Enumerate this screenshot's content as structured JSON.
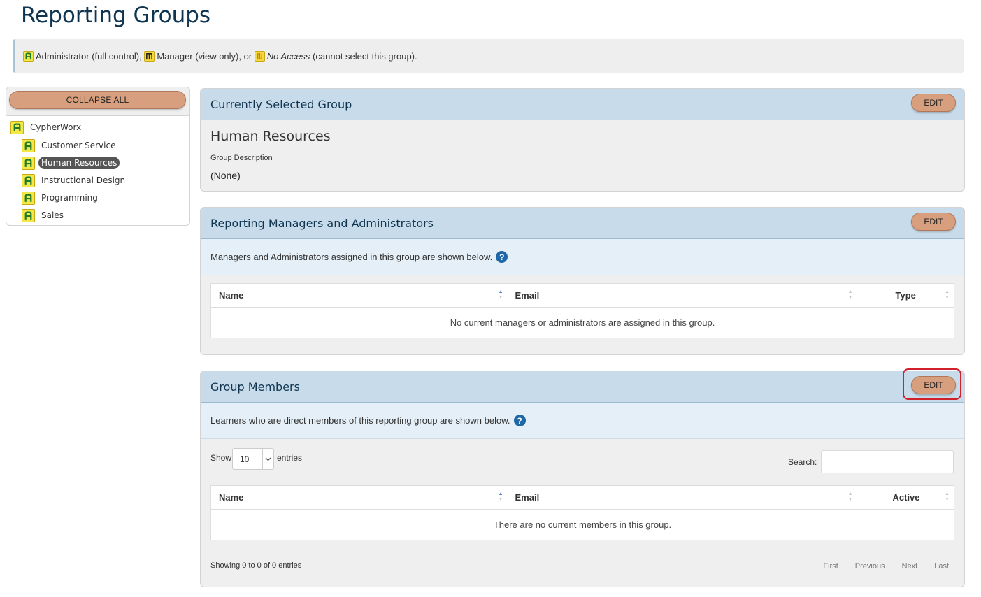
{
  "page": {
    "title": "Reporting Groups"
  },
  "legend": {
    "admin_label": "Administrator",
    "admin_desc": " (full control), ",
    "manager_label": "Manager",
    "manager_desc": " (view only), or ",
    "noaccess_label": "No Access",
    "noaccess_desc": " (cannot select this group)."
  },
  "colors": {
    "accent_button": "#d79f7e",
    "header_bg": "#c8dbea",
    "title": "#0f3550",
    "badge": "#f5d842",
    "highlight": "#d0202a"
  },
  "sidebar": {
    "collapse_label": "COLLAPSE ALL",
    "root": {
      "label": "CypherWorx",
      "icon": "admin-badge-icon"
    },
    "children": [
      {
        "label": "Customer Service",
        "icon": "admin-badge-icon"
      },
      {
        "label": "Human Resources",
        "icon": "admin-badge-icon",
        "selected": true
      },
      {
        "label": "Instructional Design",
        "icon": "admin-badge-icon"
      },
      {
        "label": "Programming",
        "icon": "admin-badge-icon"
      },
      {
        "label": "Sales",
        "icon": "admin-badge-icon"
      }
    ]
  },
  "selected_group": {
    "header": "Currently Selected Group",
    "edit_label": "EDIT",
    "name": "Human Resources",
    "description_label": "Group Description",
    "description_value": "(None)"
  },
  "managers": {
    "header": "Reporting Managers and Administrators",
    "edit_label": "EDIT",
    "info": "Managers and Administrators assigned in this group are shown below.",
    "columns": [
      "Name",
      "Email",
      "Type"
    ],
    "empty_message": "No current managers or administrators are assigned in this group."
  },
  "members": {
    "header": "Group Members",
    "edit_label": "EDIT",
    "info": "Learners who are direct members of this reporting group are shown below.",
    "show_label": "Show",
    "entries_value": "10",
    "entries_label": "entries",
    "search_label": "Search:",
    "search_value": "",
    "columns": [
      "Name",
      "Email",
      "Active"
    ],
    "empty_message": "There are no current members in this group.",
    "info_text": "Showing 0 to 0 of 0 entries",
    "pager": {
      "first": "First",
      "previous": "Previous",
      "next": "Next",
      "last": "Last"
    }
  },
  "help_icon_glyph": "?"
}
